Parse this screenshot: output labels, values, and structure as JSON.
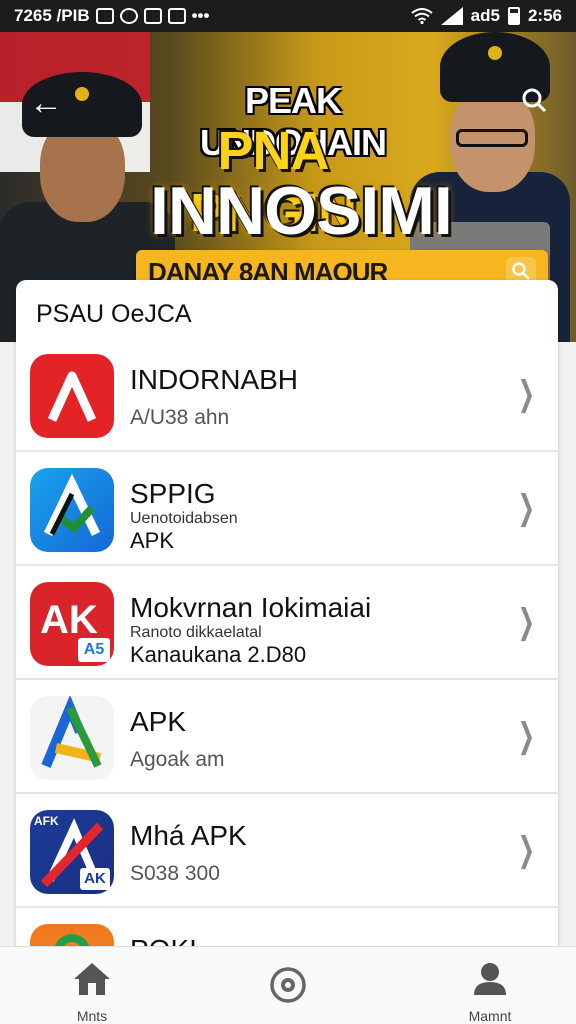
{
  "statusbar": {
    "left_text": "7265 /PIB",
    "time": "2:56",
    "signal_text": "ad5"
  },
  "banner": {
    "line1": "PEAK UNDOHAIN",
    "line2": "PNA PNGIN",
    "line3": "INNOSIMI",
    "search_text": "DANAY 8AN MAOUR"
  },
  "list": {
    "section_title": "PSAU OeJCA",
    "items": [
      {
        "name": "INDORNABH",
        "sub": "A/U38 ahn"
      },
      {
        "name": "SPPIG",
        "sub": "Uenotoidabsen",
        "sub2": "APK"
      },
      {
        "name": "Mokvrnan Iokimaiai",
        "sub": "Ranoto dikkaelatal",
        "sub2": "Kanaukana 2.D80"
      },
      {
        "name": "APK",
        "sub": "Agoak am"
      },
      {
        "name": "Mhá APK",
        "sub": "S038 300"
      },
      {
        "name": "POKI",
        "sub": ""
      }
    ],
    "icon_labels": {
      "item3": "AK",
      "item3_small": "A5",
      "item5": "AFK",
      "item5_small": "AK"
    }
  },
  "bottomnav": {
    "home_label": "Mnts",
    "discover_label": "",
    "profile_label": "Mamnt"
  }
}
